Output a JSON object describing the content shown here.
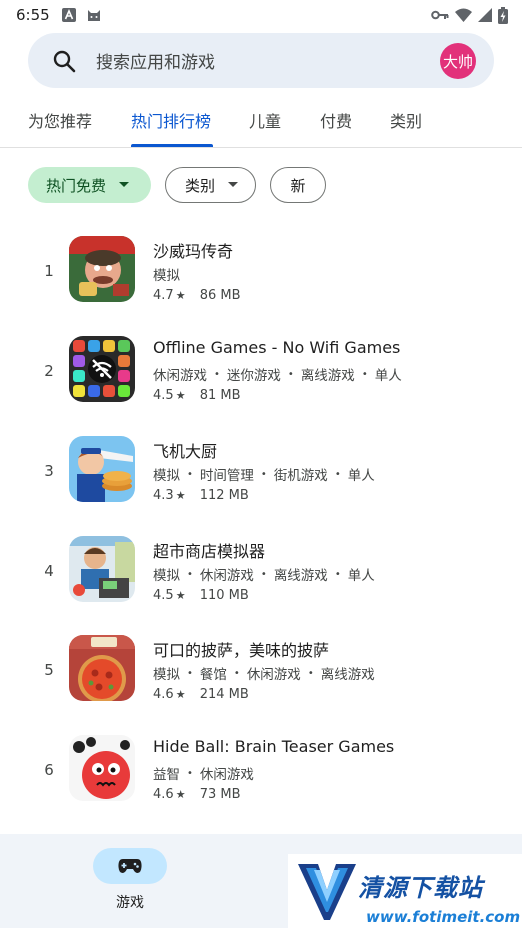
{
  "status_bar": {
    "time": "6:55"
  },
  "search": {
    "placeholder": "搜索应用和游戏",
    "avatar_text": "大帅"
  },
  "tabs": [
    {
      "label": "为您推荐"
    },
    {
      "label": "热门排行榜",
      "active": true
    },
    {
      "label": "儿童"
    },
    {
      "label": "付费"
    },
    {
      "label": "类别"
    }
  ],
  "chips": {
    "free": "热门免费",
    "category": "类别",
    "new": "新"
  },
  "apps": [
    {
      "rank": "1",
      "name": "沙威玛传奇",
      "categories": [
        "模拟"
      ],
      "rating": "4.7",
      "size": "86 MB"
    },
    {
      "rank": "2",
      "name": "Offline Games - No Wifi Games",
      "categories": [
        "休闲游戏",
        "迷你游戏",
        "离线游戏",
        "单人"
      ],
      "rating": "4.5",
      "size": "81 MB"
    },
    {
      "rank": "3",
      "name": "飞机大厨",
      "categories": [
        "模拟",
        "时间管理",
        "街机游戏",
        "单人"
      ],
      "rating": "4.3",
      "size": "112 MB"
    },
    {
      "rank": "4",
      "name": "超市商店模拟器",
      "categories": [
        "模拟",
        "休闲游戏",
        "离线游戏",
        "单人"
      ],
      "rating": "4.5",
      "size": "110 MB"
    },
    {
      "rank": "5",
      "name": "可口的披萨，美味的披萨",
      "categories": [
        "模拟",
        "餐馆",
        "休闲游戏",
        "离线游戏"
      ],
      "rating": "4.6",
      "size": "214 MB"
    },
    {
      "rank": "6",
      "name": "Hide Ball: Brain Teaser Games",
      "categories": [
        "益智",
        "休闲游戏"
      ],
      "rating": "4.6",
      "size": "73 MB"
    }
  ],
  "bottom_nav": {
    "games_label": "游戏"
  },
  "watermark": {
    "title": "清源下载站",
    "url": "www.fotimeit.com"
  },
  "colors": {
    "accent": "#0b57d0",
    "chip_active": "#c4eed0",
    "nav_active": "#c2e7ff",
    "avatar": "#e2317a"
  }
}
